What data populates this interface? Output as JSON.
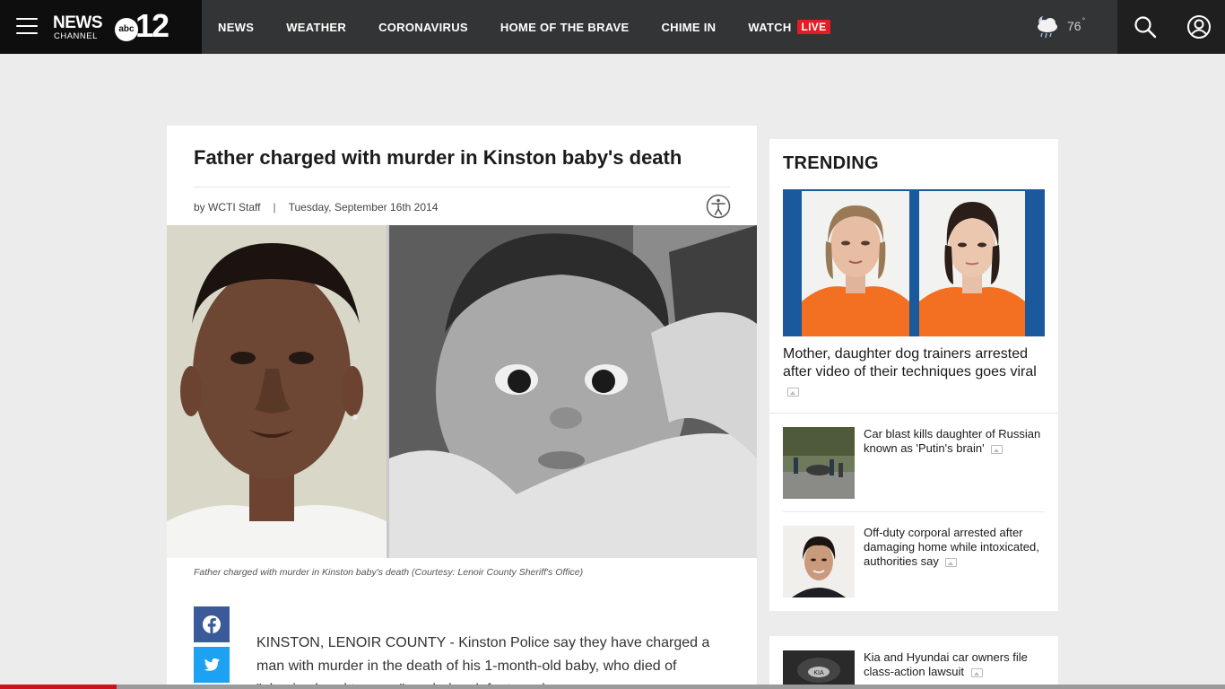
{
  "header": {
    "logo": {
      "brand": "NEWS",
      "sub": "CHANNEL",
      "network": "abc",
      "number": "12"
    },
    "nav": [
      {
        "label": "NEWS"
      },
      {
        "label": "WEATHER"
      },
      {
        "label": "CORONAVIRUS"
      },
      {
        "label": "HOME OF THE BRAVE"
      },
      {
        "label": "CHIME IN"
      },
      {
        "label": "WATCH",
        "badge": "LIVE"
      }
    ],
    "weather": {
      "temp": "76",
      "unit": "°",
      "icon": "rain-cloud-moon-icon"
    },
    "icons": {
      "menu": "hamburger-menu-icon",
      "search": "search-icon",
      "account": "user-account-icon"
    }
  },
  "article": {
    "headline": "Father charged with murder in Kinston baby's death",
    "author": "by WCTI Staff",
    "separator": "|",
    "date": "Tuesday, September 16th 2014",
    "caption": "Father charged with murder in Kinston baby's death (Courtesy: Lenoir County Sheriff's Office)",
    "body_lines": [
      "KINSTON, LENOIR COUNTY - Kinston Police say they have charged a",
      "man with murder in the death of his 1-month-old baby, who died of",
      "\"abusive head trauma,\" or shaken infant syndrome."
    ],
    "share": [
      {
        "icon": "facebook-icon"
      },
      {
        "icon": "twitter-icon"
      }
    ]
  },
  "trending": {
    "title": "TRENDING",
    "hero": {
      "title": "Mother, daughter dog trainers arrested after video of their techniques goes viral"
    },
    "items": [
      {
        "title": "Car blast kills daughter of Russian known as 'Putin's brain'"
      },
      {
        "title": "Off-duty corporal arrested after damaging home while intoxicated, authorities say"
      },
      {
        "title": "Kia and Hyundai car owners file class-action lawsuit"
      }
    ]
  },
  "scroll_progress": 0.095,
  "colors": {
    "live": "#e41c23",
    "facebook": "#3a5a99",
    "twitter": "#1da1f2",
    "progress": "#d0111b"
  }
}
